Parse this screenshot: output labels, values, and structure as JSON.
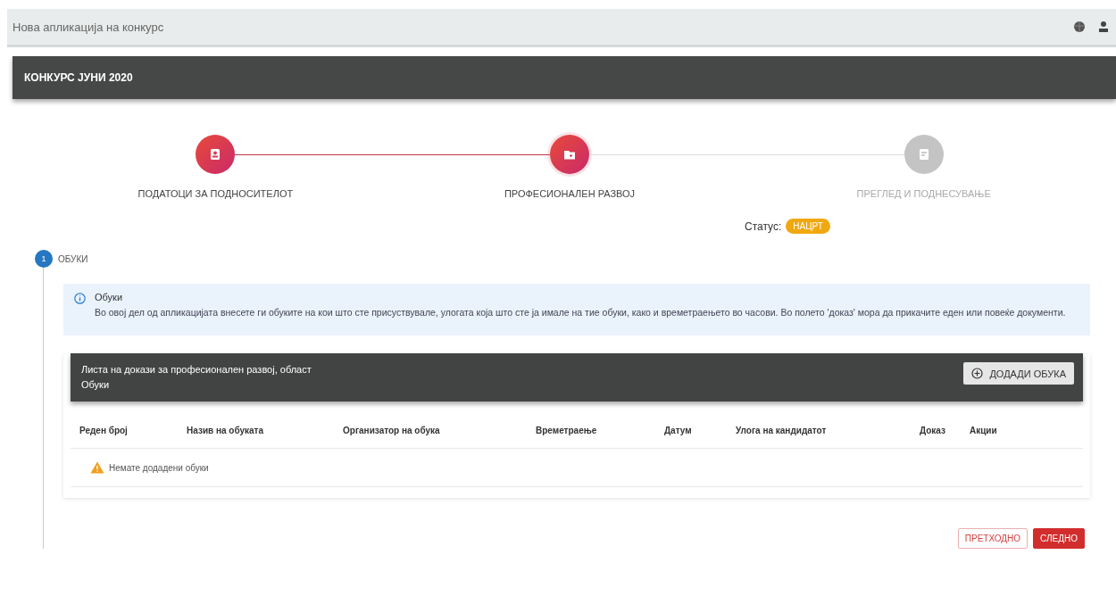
{
  "app_bar": {
    "title": "Нова апликација на конкурс"
  },
  "contest_bar": {
    "title": "КОНКУРС ЈУНИ 2020"
  },
  "steps": [
    {
      "label": "ПОДАТОЦИ ЗА ПОДНОСИТЕЛОТ",
      "kind": "done"
    },
    {
      "label": "ПРОФЕСИОНАЛЕН РАЗВОЈ",
      "kind": "active"
    },
    {
      "label": "ПРЕГЛЕД И ПОДНЕСУВАЊЕ",
      "kind": "pending"
    }
  ],
  "status": {
    "label": "Статус:",
    "value": "НАЦРТ"
  },
  "section": {
    "number": "1",
    "title": "ОБУКИ"
  },
  "info": {
    "title": "Обуки",
    "text": "Во овој дел од апликацијата внесете ги обуките на кои што сте присуствувале, улогата која што сте ја имале на тие обуки, како и времетраењето во часови. Во полето 'доказ' мора да прикачите еден или повеќе документи."
  },
  "table": {
    "title": "Листа на докази за професионален развој, област",
    "subtitle": "Обуки",
    "add_button": "ДОДАДИ ОБУКА",
    "columns": [
      "Реден број",
      "Назив на обуката",
      "Организатор на обука",
      "Времетраење",
      "Датум",
      "Улога на кандидатот",
      "Доказ",
      "Акции"
    ],
    "empty_message": "Немате додадени обуки"
  },
  "buttons": [
    {
      "label": "ПРЕТХОДНО",
      "kind": "outline"
    },
    {
      "label": "СЛЕДНО",
      "kind": "primary"
    }
  ]
}
